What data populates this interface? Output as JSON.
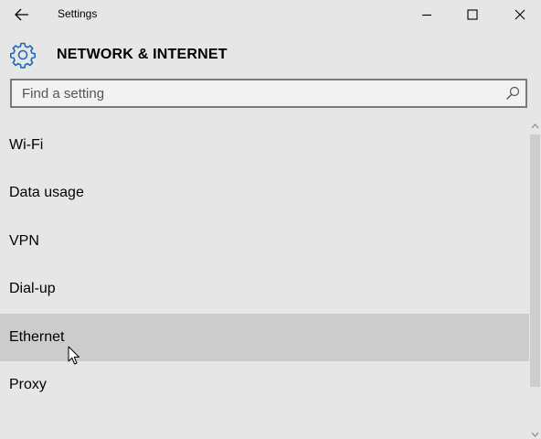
{
  "window": {
    "title": "Settings",
    "controls": {
      "minimize": "minimize-icon",
      "maximize": "maximize-icon",
      "close": "close-icon"
    }
  },
  "header": {
    "icon": "gear-icon",
    "title": "NETWORK & INTERNET"
  },
  "search": {
    "placeholder": "Find a setting",
    "value": "",
    "icon": "search-icon"
  },
  "menu": {
    "items": [
      {
        "label": "Wi-Fi"
      },
      {
        "label": "Data usage"
      },
      {
        "label": "VPN"
      },
      {
        "label": "Dial-up"
      },
      {
        "label": "Ethernet",
        "state": "hovered"
      },
      {
        "label": "Proxy"
      }
    ]
  },
  "colors": {
    "background": "#e6e6e6",
    "hover": "#cccccc",
    "accent": "#1e6ab4",
    "search_border": "#7a7a7a"
  }
}
